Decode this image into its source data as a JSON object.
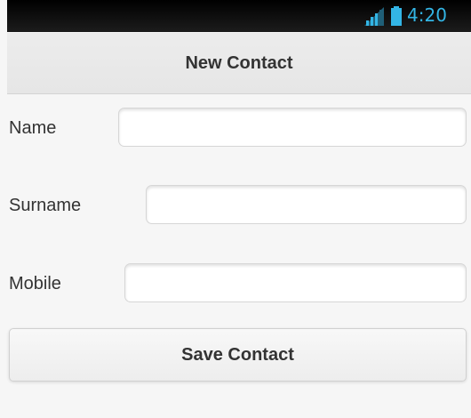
{
  "status_bar": {
    "time": "4:20",
    "signal_icon": "signal-icon",
    "battery_icon": "battery-icon",
    "accent_color": "#33b5e5"
  },
  "header": {
    "title": "New Contact"
  },
  "form": {
    "fields": [
      {
        "label": "Name",
        "value": "",
        "placeholder": ""
      },
      {
        "label": "Surname",
        "value": "",
        "placeholder": ""
      },
      {
        "label": "Mobile",
        "value": "",
        "placeholder": ""
      }
    ],
    "save_label": "Save Contact"
  }
}
